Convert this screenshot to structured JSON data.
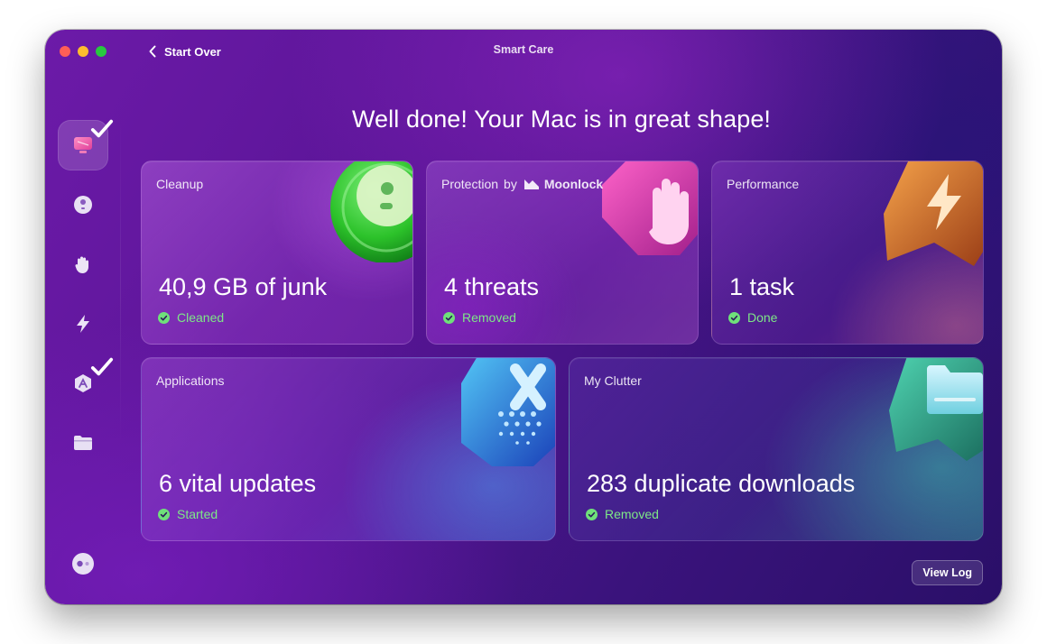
{
  "window": {
    "title": "Smart Care",
    "back_label": "Start Over"
  },
  "sidebar": {
    "items": [
      {
        "name": "smart-care",
        "icon": "smart-care-icon",
        "active": true,
        "checked": true
      },
      {
        "name": "cleanup",
        "icon": "cleanup-icon",
        "active": false,
        "checked": false
      },
      {
        "name": "protection",
        "icon": "hand-icon",
        "active": false,
        "checked": false
      },
      {
        "name": "performance",
        "icon": "bolt-icon",
        "active": false,
        "checked": false
      },
      {
        "name": "applications",
        "icon": "applications-icon",
        "active": false,
        "checked": true
      },
      {
        "name": "my-clutter",
        "icon": "folder-icon",
        "active": false,
        "checked": false
      }
    ],
    "assistant_icon": "assistant-icon"
  },
  "headline": "Well done! Your Mac is in great shape!",
  "cards": {
    "cleanup": {
      "label": "Cleanup",
      "value": "40,9 GB of junk",
      "status": "Cleaned"
    },
    "protection": {
      "label": "Protection",
      "label_by": "by",
      "brand": "Moonlock",
      "value": "4 threats",
      "status": "Removed"
    },
    "performance": {
      "label": "Performance",
      "value": "1 task",
      "status": "Done"
    },
    "applications": {
      "label": "Applications",
      "value": "6 vital updates",
      "status": "Started"
    },
    "clutter": {
      "label": "My Clutter",
      "value": "283 duplicate downloads",
      "status": "Removed"
    }
  },
  "footer": {
    "view_log_label": "View Log"
  },
  "colors": {
    "accent_status": "#7ee787",
    "traffic_red": "#ff5f57",
    "traffic_yellow": "#febc2e",
    "traffic_green": "#28c840"
  }
}
